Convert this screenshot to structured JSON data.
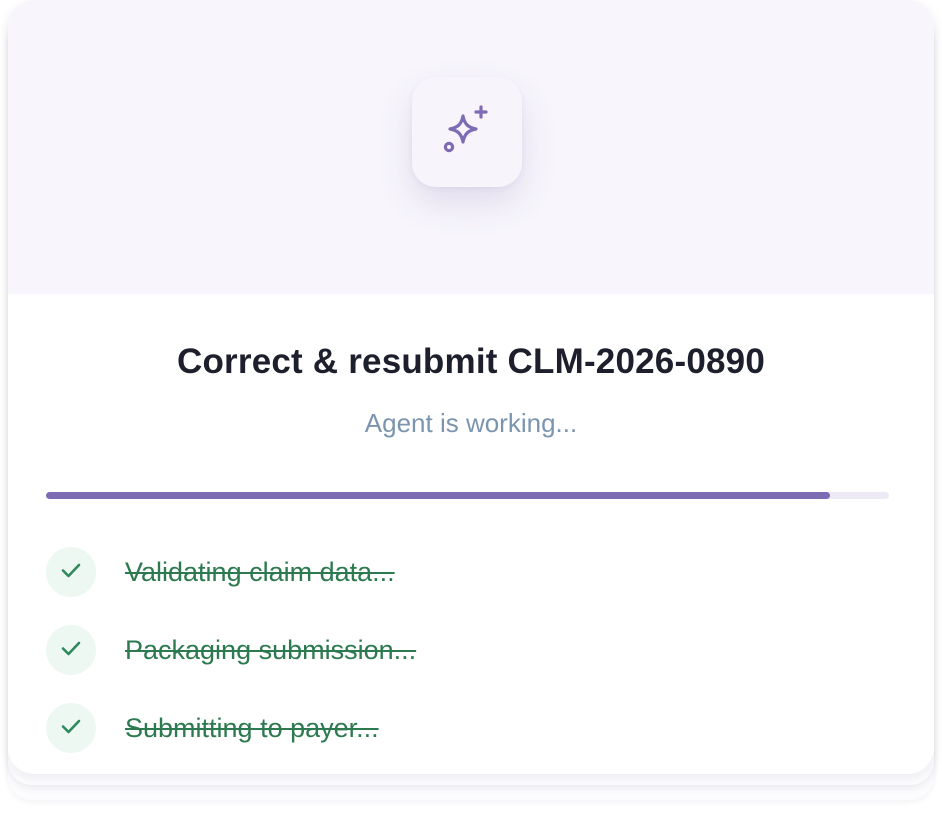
{
  "task": {
    "title": "Correct & resubmit CLM-2026-0890",
    "status_text": "Agent is working..."
  },
  "progress": {
    "percent": 93
  },
  "steps": [
    {
      "label": "Validating claim data...",
      "state": "done",
      "icon": "check-icon"
    },
    {
      "label": "Packaging submission...",
      "state": "done",
      "icon": "check-icon"
    },
    {
      "label": "Submitting to payer...",
      "state": "done",
      "icon": "check-icon"
    }
  ],
  "icons": {
    "hero": "sparkles-icon"
  },
  "colors": {
    "accent": "#7d6cb4",
    "done": "#2e7a50",
    "done_bg": "#edf8f3",
    "hero_bg": "#f8f6fc"
  }
}
